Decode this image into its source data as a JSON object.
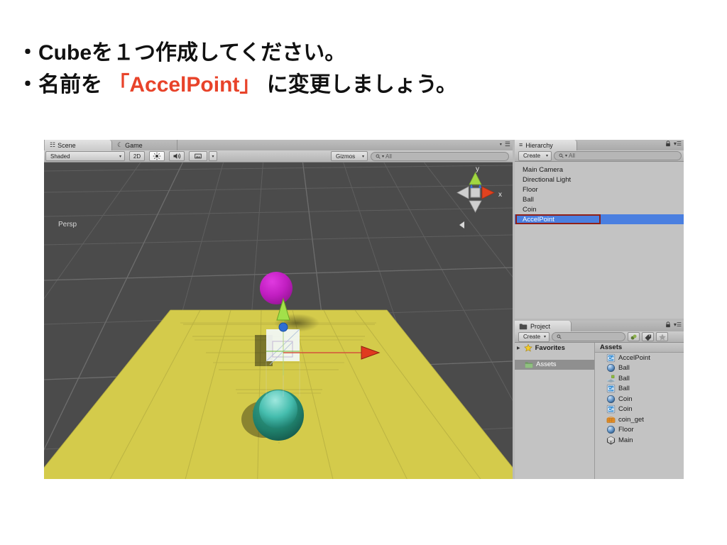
{
  "slide": {
    "line1": "・Cubeを１つ作成してください。",
    "line2_prefix": "・名前を ",
    "line2_accent": "「AccelPoint」",
    "line2_suffix": " に変更しましょう。",
    "accent_color": "#e8432a"
  },
  "scene_view": {
    "tabs": [
      {
        "label": "Scene",
        "icon": "grid-hash-icon",
        "active": true
      },
      {
        "label": "Game",
        "icon": "gamepad-icon",
        "active": false
      }
    ],
    "toolbar": {
      "draw_mode": "Shaded",
      "mode_2d": "2D",
      "lighting_icon": "sun-icon",
      "audio_icon": "speaker-icon",
      "fx_icon": "image-icon",
      "gizmos_label": "Gizmos",
      "search_placeholder": "All",
      "search_value": ""
    },
    "gizmo": {
      "y_axis_label": "y",
      "x_axis_label": "x",
      "projection_label": "Persp",
      "y_color": "#a2d742",
      "x_color": "#e0421f",
      "z_color": "#3a6fd8"
    },
    "objects": {
      "floor_color": "#d4cb4b",
      "ball_color": "#c11ec1",
      "coin_color": "#1f8a76",
      "cube_color": "#f2f7f7",
      "move_gizmo_up_color": "#a2e04a",
      "move_gizmo_right_color": "#e03a1f",
      "move_gizmo_center_color": "#2e6ed4",
      "background_color": "#4b4b4b"
    }
  },
  "hierarchy": {
    "tab_label": "Hierarchy",
    "tab_icon": "hierarchy-icon",
    "create_label": "Create",
    "search_placeholder": "All",
    "lock_icon": "lock-icon",
    "menu_icon": "hamburger-menu-icon",
    "items": [
      {
        "label": "Main Camera",
        "selected": false
      },
      {
        "label": "Directional Light",
        "selected": false
      },
      {
        "label": "Floor",
        "selected": false
      },
      {
        "label": "Ball",
        "selected": false
      },
      {
        "label": "Coin",
        "selected": false
      },
      {
        "label": "AccelPoint",
        "selected": true
      }
    ],
    "selection_color": "#4a7fe0",
    "highlight_box_color": "#8f2018"
  },
  "project": {
    "tab_label": "Project",
    "tab_icon": "folder-icon",
    "create_label": "Create",
    "search_placeholder": "",
    "lock_icon": "lock-icon",
    "menu_icon": "hamburger-menu-icon",
    "filter_buttons": [
      {
        "name": "filter-by-type-icon"
      },
      {
        "name": "filter-by-label-icon"
      },
      {
        "name": "favorite-star-icon"
      }
    ],
    "tree": [
      {
        "label": "Favorites",
        "icon": "star-icon",
        "expandable": true,
        "selected": false
      },
      {
        "label": "Assets",
        "icon": "folder-icon",
        "expandable": false,
        "selected": true
      }
    ],
    "assets_header": "Assets",
    "assets": [
      {
        "label": "AccelPoint",
        "icon": "csharp-script-icon"
      },
      {
        "label": "Ball",
        "icon": "material-icon"
      },
      {
        "label": "Ball",
        "icon": "prefab-icon"
      },
      {
        "label": "Ball",
        "icon": "csharp-script-icon"
      },
      {
        "label": "Coin",
        "icon": "material-icon"
      },
      {
        "label": "Coin",
        "icon": "csharp-script-icon"
      },
      {
        "label": "coin_get",
        "icon": "audio-clip-icon"
      },
      {
        "label": "Floor",
        "icon": "material-icon"
      },
      {
        "label": "Main",
        "icon": "unity-scene-icon"
      }
    ]
  }
}
